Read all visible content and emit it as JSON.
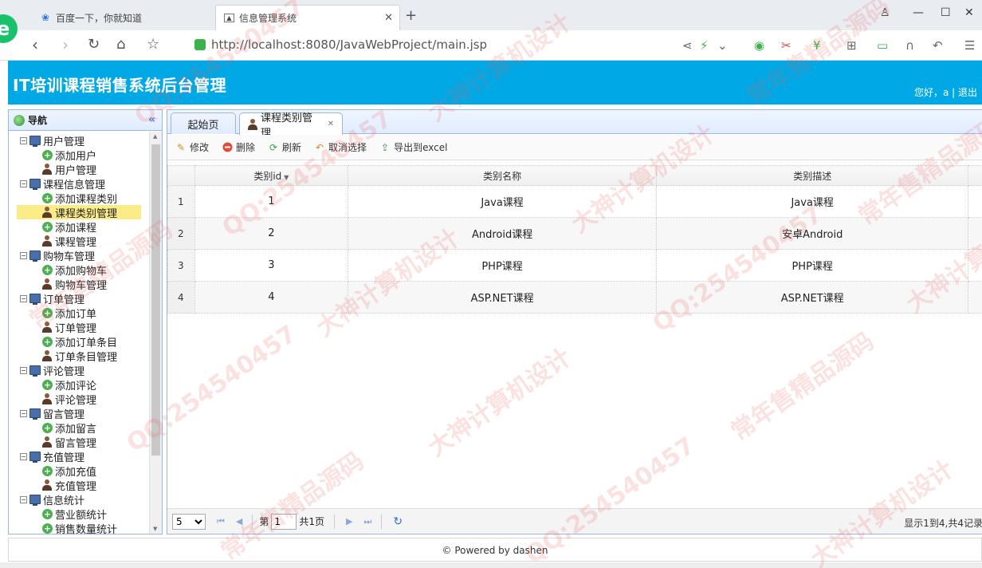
{
  "browser": {
    "tabs": [
      {
        "label": "百度一下，你就知道",
        "icon": "paw-icon"
      },
      {
        "label": "信息管理系统",
        "icon": "image-icon",
        "active": true
      }
    ],
    "url": "http://localhost:8080/JavaWebProject/main.jsp"
  },
  "app": {
    "title": "IT培训课程销售系统后台管理",
    "welcome": "您好，a | 退出",
    "footer": "© Powered by dashen"
  },
  "nav": {
    "title": "导航",
    "items": [
      {
        "label": "用户管理",
        "type": "group"
      },
      {
        "label": "添加用户",
        "type": "add"
      },
      {
        "label": "用户管理",
        "type": "user"
      },
      {
        "label": "课程信息管理",
        "type": "group"
      },
      {
        "label": "添加课程类别",
        "type": "add"
      },
      {
        "label": "课程类别管理",
        "type": "user",
        "selected": true
      },
      {
        "label": "添加课程",
        "type": "add"
      },
      {
        "label": "课程管理",
        "type": "user"
      },
      {
        "label": "购物车管理",
        "type": "group"
      },
      {
        "label": "添加购物车",
        "type": "add"
      },
      {
        "label": "购物车管理",
        "type": "user"
      },
      {
        "label": "订单管理",
        "type": "group"
      },
      {
        "label": "添加订单",
        "type": "add"
      },
      {
        "label": "订单管理",
        "type": "user"
      },
      {
        "label": "添加订单条目",
        "type": "add"
      },
      {
        "label": "订单条目管理",
        "type": "user"
      },
      {
        "label": "评论管理",
        "type": "group"
      },
      {
        "label": "添加评论",
        "type": "add"
      },
      {
        "label": "评论管理",
        "type": "user"
      },
      {
        "label": "留言管理",
        "type": "group"
      },
      {
        "label": "添加留言",
        "type": "add"
      },
      {
        "label": "留言管理",
        "type": "user"
      },
      {
        "label": "充值管理",
        "type": "group"
      },
      {
        "label": "添加充值",
        "type": "add"
      },
      {
        "label": "充值管理",
        "type": "user"
      },
      {
        "label": "信息统计",
        "type": "group"
      },
      {
        "label": "营业额统计",
        "type": "add"
      },
      {
        "label": "销售数量统计",
        "type": "add"
      }
    ]
  },
  "content": {
    "tabs": {
      "home": "起始页",
      "active": "课程类别管理"
    },
    "toolbar": {
      "edit": "修改",
      "delete": "删除",
      "refresh": "刷新",
      "cancel": "取消选择",
      "export": "导出到excel"
    },
    "grid": {
      "headers": [
        "类别id",
        "类别名称",
        "类别描述"
      ],
      "rows": [
        {
          "rownum": "1",
          "id": "1",
          "name": "Java课程",
          "desc": "Java课程"
        },
        {
          "rownum": "2",
          "id": "2",
          "name": "Android课程",
          "desc": "安卓Android"
        },
        {
          "rownum": "3",
          "id": "3",
          "name": "PHP课程",
          "desc": "PHP课程"
        },
        {
          "rownum": "4",
          "id": "4",
          "name": "ASP.NET课程",
          "desc": "ASP.NET课程"
        }
      ]
    },
    "pager": {
      "page_size": "5",
      "page_prefix": "第",
      "page_value": "1",
      "page_total": "共1页",
      "info": "显示1到4,共4记录"
    }
  },
  "watermark": {
    "texts": [
      "QQ:254540457",
      "大神计算机设计",
      "常年售精品源码"
    ]
  }
}
